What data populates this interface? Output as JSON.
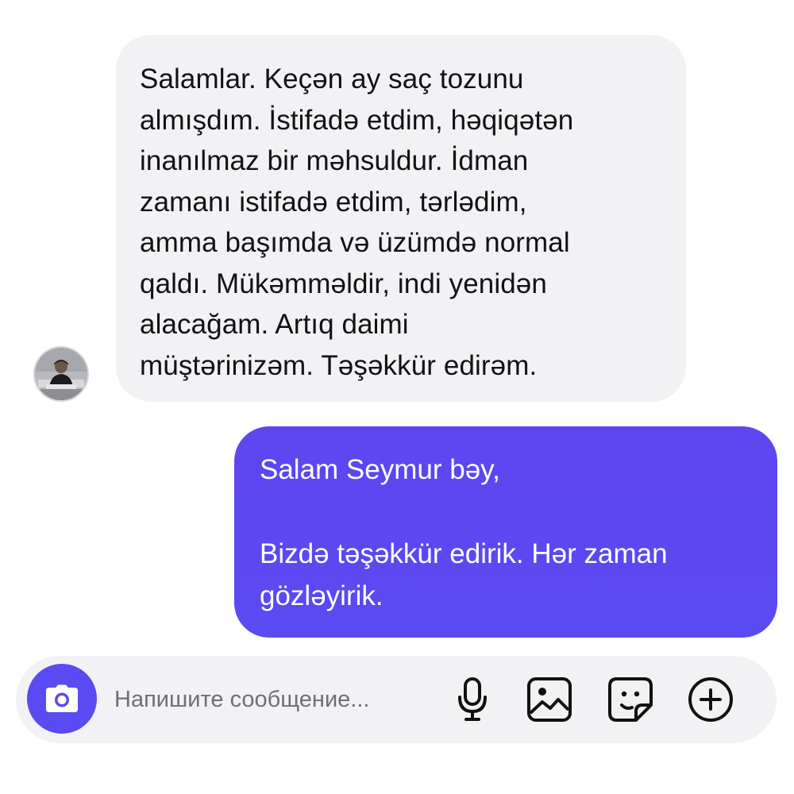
{
  "conversation": {
    "incoming": {
      "lines": [
        "Salamlar. Keçən ay saç tozunu",
        "almışdım. İstifadə etdim, həqiqətən",
        "inanılmaz bir məhsuldur. İdman",
        "zamanı istifadə etdim, tərlədim,",
        "amma başımda və üzümdə normal",
        "qaldı. Mükəmməldir, indi yenidən",
        "alacağam. Artıq daimi",
        "müştərinizəm. Təşəkkür edirəm."
      ]
    },
    "outgoing": {
      "lines": [
        "Salam Seymur bəy,",
        "",
        "Bizdə təşəkkür edirik. Hər zaman",
        "gözləyirik."
      ]
    }
  },
  "composer": {
    "placeholder": "Напишите сообщение...",
    "value": "",
    "icons": [
      "camera-icon",
      "microphone-icon",
      "gallery-icon",
      "sticker-icon",
      "add-icon"
    ]
  },
  "colors": {
    "accent": "#5a4af1",
    "incoming_bubble": "#f2f2f4",
    "outgoing_text": "#ffffff",
    "incoming_text": "#121214"
  }
}
